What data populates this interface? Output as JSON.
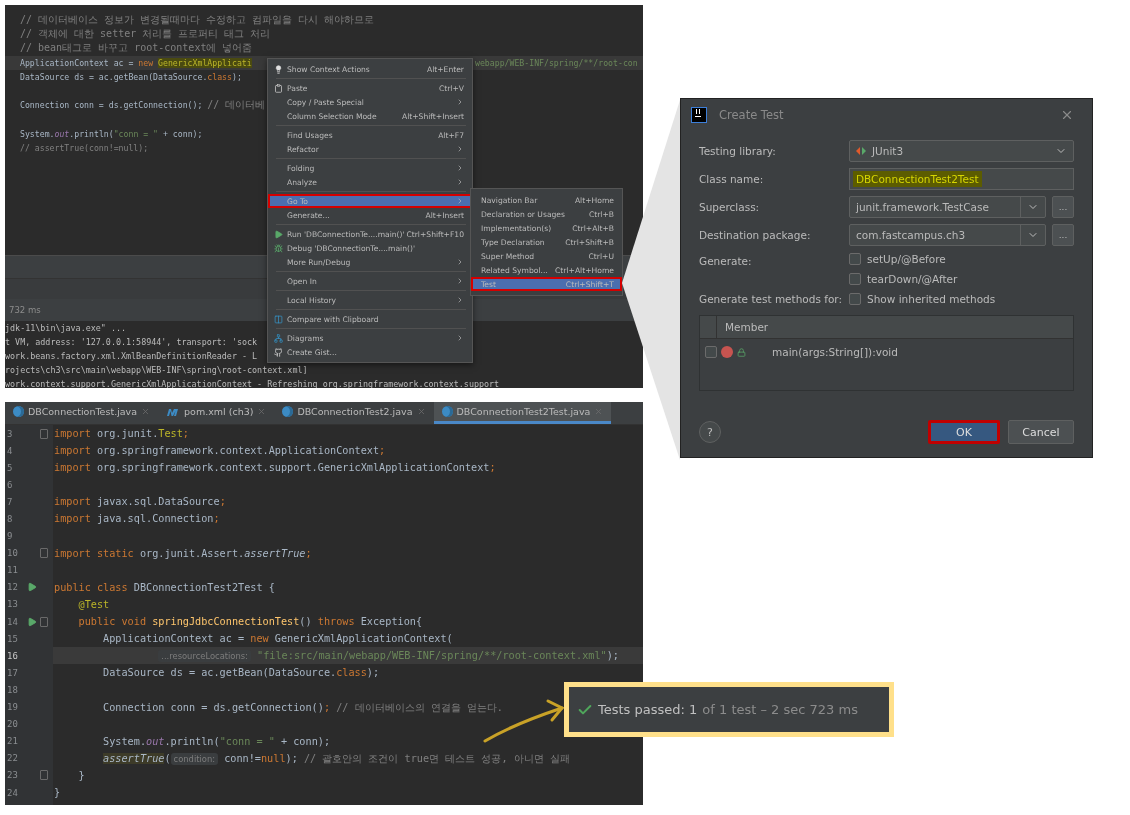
{
  "top_editor": {
    "lines": [
      {
        "current": false,
        "segments": [
          {
            "text": "// 데이터베이스 정보가 변경될때마다 수정하고 컴파일을 다시 해야하므로",
            "kind": "comment"
          }
        ]
      },
      {
        "current": false,
        "segments": [
          {
            "text": "// 객체에 대한 setter 처리를 프로퍼티 태그 처리",
            "kind": "comment"
          }
        ]
      },
      {
        "current": false,
        "segments": [
          {
            "text": "// bean태그로 바꾸고 root-context에 넣어줌",
            "kind": "comment"
          }
        ]
      },
      {
        "current": true,
        "segments": [
          {
            "text": "ApplicationContext ac = ",
            "kind": "plain"
          },
          {
            "text": "new ",
            "kind": "keyword"
          },
          {
            "text": "GenericXmlApplicati",
            "kind": "highlight"
          }
        ],
        "tail": {
          "text": "webapp/WEB-INF/spring/**/root-con",
          "kind": "string"
        }
      },
      {
        "current": false,
        "segments": [
          {
            "text": "DataSource ds = ac.getBean(DataSource.",
            "kind": "plain"
          },
          {
            "text": "class",
            "kind": "keyword"
          },
          {
            "text": ");",
            "kind": "plain"
          }
        ]
      },
      {
        "current": false
      },
      {
        "current": false,
        "segments": [
          {
            "text": "Connection conn = ds.getConnection(); ",
            "kind": "plain"
          },
          {
            "text": "// 데이터베",
            "kind": "comment"
          }
        ]
      },
      {
        "current": false
      },
      {
        "current": false,
        "segments": [
          {
            "text": "System.",
            "kind": "plain"
          },
          {
            "text": "out",
            "kind": "static"
          },
          {
            "text": ".println(",
            "kind": "plain"
          },
          {
            "text": "\"conn = \"",
            "kind": "string"
          },
          {
            "text": " + conn);",
            "kind": "plain"
          }
        ]
      },
      {
        "current": false,
        "segments": [
          {
            "text": "// assertTrue(conn!=null);",
            "kind": "comment"
          }
        ]
      }
    ]
  },
  "console": {
    "duration": "732 ms",
    "lines": [
      "jdk-11\\bin\\java.exe\" ...",
      "t VM, address: '127.0.0.1:58944', transport: 'sock",
      "work.beans.factory.xml.XmlBeanDefinitionReader - L",
      "rojects\\ch3\\src\\main\\webapp\\WEB-INF\\spring\\root-context.xml]",
      "work.context.support.GenericXmlApplicationContext - Refreshing org.springframework.context.support"
    ]
  },
  "context_menu": {
    "items": [
      {
        "kind": "item",
        "label": "Show Context Actions",
        "shortcut": "Alt+Enter",
        "submenu": false,
        "selected": false,
        "outlined": false
      },
      {
        "kind": "separator"
      },
      {
        "kind": "item",
        "label": "Paste",
        "shortcut": "Ctrl+V",
        "submenu": false,
        "selected": false,
        "outlined": false
      },
      {
        "kind": "item",
        "label": "Copy / Paste Special",
        "submenu": true,
        "selected": false,
        "outlined": false
      },
      {
        "kind": "item",
        "label": "Column Selection Mode",
        "shortcut": "Alt+Shift+Insert",
        "submenu": false,
        "selected": false,
        "outlined": false
      },
      {
        "kind": "separator"
      },
      {
        "kind": "item",
        "label": "Find Usages",
        "shortcut": "Alt+F7",
        "submenu": false,
        "selected": false,
        "outlined": false
      },
      {
        "kind": "item",
        "label": "Refactor",
        "submenu": true,
        "selected": false,
        "outlined": false
      },
      {
        "kind": "separator"
      },
      {
        "kind": "item",
        "label": "Folding",
        "submenu": true,
        "selected": false,
        "outlined": false
      },
      {
        "kind": "item",
        "label": "Analyze",
        "submenu": true,
        "selected": false,
        "outlined": false
      },
      {
        "kind": "separator"
      },
      {
        "kind": "item",
        "label": "Go To",
        "submenu": true,
        "selected": true,
        "outlined": true
      },
      {
        "kind": "item",
        "label": "Generate...",
        "shortcut": "Alt+Insert",
        "submenu": false,
        "selected": false,
        "outlined": false
      },
      {
        "kind": "separator"
      },
      {
        "kind": "item",
        "label": "Run 'DBConnectionTe....main()'",
        "shortcut": "Ctrl+Shift+F10",
        "submenu": false,
        "selected": false,
        "outlined": false
      },
      {
        "kind": "item",
        "label": "Debug 'DBConnectionTe....main()'",
        "submenu": false,
        "selected": false,
        "outlined": false
      },
      {
        "kind": "item",
        "label": "More Run/Debug",
        "submenu": true,
        "selected": false,
        "outlined": false
      },
      {
        "kind": "separator"
      },
      {
        "kind": "item",
        "label": "Open In",
        "submenu": true,
        "selected": false,
        "outlined": false
      },
      {
        "kind": "separator"
      },
      {
        "kind": "item",
        "label": "Local History",
        "submenu": true,
        "selected": false,
        "outlined": false
      },
      {
        "kind": "separator"
      },
      {
        "kind": "item",
        "label": "Compare with Clipboard",
        "submenu": false,
        "selected": false,
        "outlined": false
      },
      {
        "kind": "separator"
      },
      {
        "kind": "item",
        "label": "Diagrams",
        "submenu": true,
        "selected": false,
        "outlined": false
      },
      {
        "kind": "item",
        "label": "Create Gist...",
        "submenu": false,
        "selected": false,
        "outlined": false
      }
    ]
  },
  "submenu": {
    "items": [
      {
        "label": "Navigation Bar",
        "shortcut": "Alt+Home",
        "selected": false,
        "outlined": false
      },
      {
        "label": "Declaration or Usages",
        "shortcut": "Ctrl+B",
        "selected": false,
        "outlined": false
      },
      {
        "label": "Implementation(s)",
        "shortcut": "Ctrl+Alt+B",
        "selected": false,
        "outlined": false
      },
      {
        "label": "Type Declaration",
        "shortcut": "Ctrl+Shift+B",
        "selected": false,
        "outlined": false
      },
      {
        "label": "Super Method",
        "shortcut": "Ctrl+U",
        "selected": false,
        "outlined": false
      },
      {
        "label": "Related Symbol...",
        "shortcut": "Ctrl+Alt+Home",
        "selected": false,
        "outlined": false
      },
      {
        "label": "Test",
        "shortcut": "Ctrl+Shift+T",
        "selected": true,
        "outlined": true
      }
    ]
  },
  "dialog": {
    "title": "Create Test",
    "testing_library": {
      "label": "Testing library:",
      "value": "JUnit3"
    },
    "class_name": {
      "label": "Class name:",
      "value": "DBConnectionTest2Test",
      "highlighted": true
    },
    "superclass": {
      "label": "Superclass:",
      "value": "junit.framework.TestCase",
      "browse": "..."
    },
    "destination_package": {
      "label": "Destination package:",
      "value": "com.fastcampus.ch3",
      "browse": "..."
    },
    "generate": {
      "label": "Generate:",
      "options": [
        {
          "label": "setUp/@Before",
          "checked": false
        },
        {
          "label": "tearDown/@After",
          "checked": false
        }
      ]
    },
    "test_methods": {
      "label": "Generate test methods for:",
      "option": {
        "label": "Show inherited methods",
        "checked": false
      }
    },
    "members": {
      "column": "Member",
      "rows": [
        {
          "name": "main(args:String[]):void",
          "checked": false
        }
      ]
    },
    "help": "?",
    "buttons": [
      {
        "label": "OK",
        "primary": true,
        "outlined": true
      },
      {
        "label": "Cancel",
        "primary": false,
        "outlined": false
      }
    ]
  },
  "bottom_editor": {
    "tabs": [
      {
        "label": "DBConnectionTest.java",
        "kind": "java",
        "selected": false
      },
      {
        "label": "pom.xml (ch3)",
        "kind": "maven",
        "selected": false
      },
      {
        "label": "DBConnectionTest2.java",
        "kind": "java",
        "selected": false
      },
      {
        "label": "DBConnectionTest2Test.java",
        "kind": "java",
        "selected": true
      }
    ],
    "lines": [
      {
        "number": "3",
        "current": false,
        "run": false,
        "fold": true,
        "segments": [
          {
            "text": "import",
            "kind": "keyword"
          },
          {
            "text": " org.junit.",
            "kind": "plain"
          },
          {
            "text": "Test",
            "kind": "annotation"
          },
          {
            "text": ";",
            "kind": "keyword"
          }
        ]
      },
      {
        "number": "4",
        "current": false,
        "run": false,
        "fold": false,
        "segments": [
          {
            "text": "import",
            "kind": "keyword"
          },
          {
            "text": " org.springframework.context.ApplicationContext",
            "kind": "plain"
          },
          {
            "text": ";",
            "kind": "keyword"
          }
        ]
      },
      {
        "number": "5",
        "current": false,
        "run": false,
        "fold": false,
        "segments": [
          {
            "text": "import",
            "kind": "keyword"
          },
          {
            "text": " org.springframework.context.support.GenericXmlApplicationContext",
            "kind": "plain"
          },
          {
            "text": ";",
            "kind": "keyword"
          }
        ]
      },
      {
        "number": "6",
        "current": false,
        "run": false,
        "fold": false
      },
      {
        "number": "7",
        "current": false,
        "run": false,
        "fold": false,
        "segments": [
          {
            "text": "import",
            "kind": "keyword"
          },
          {
            "text": " javax.sql.DataSource",
            "kind": "plain"
          },
          {
            "text": ";",
            "kind": "keyword"
          }
        ]
      },
      {
        "number": "8",
        "current": false,
        "run": false,
        "fold": false,
        "segments": [
          {
            "text": "import",
            "kind": "keyword"
          },
          {
            "text": " java.sql.Connection",
            "kind": "plain"
          },
          {
            "text": ";",
            "kind": "keyword"
          }
        ]
      },
      {
        "number": "9",
        "current": false,
        "run": false,
        "fold": false
      },
      {
        "number": "10",
        "current": false,
        "run": false,
        "fold": true,
        "segments": [
          {
            "text": "import static",
            "kind": "keyword"
          },
          {
            "text": " org.junit.Assert.",
            "kind": "plain"
          },
          {
            "text": "assertTrue",
            "kind": "italic"
          },
          {
            "text": ";",
            "kind": "keyword"
          }
        ]
      },
      {
        "number": "11",
        "current": false,
        "run": false,
        "fold": false
      },
      {
        "number": "12",
        "current": false,
        "run": true,
        "fold": false,
        "segments": [
          {
            "text": "public class",
            "kind": "keyword"
          },
          {
            "text": " DBConnectionTest2Test {",
            "kind": "plain"
          }
        ]
      },
      {
        "number": "13",
        "current": false,
        "run": false,
        "fold": false,
        "segments": [
          {
            "text": "    @Test",
            "kind": "annotation"
          }
        ]
      },
      {
        "number": "14",
        "current": false,
        "run": true,
        "fold": true,
        "segments": [
          {
            "text": "    public void ",
            "kind": "keyword"
          },
          {
            "text": "springJdbcConnectionTest",
            "kind": "method"
          },
          {
            "text": "() ",
            "kind": "plain"
          },
          {
            "text": "throws",
            "kind": "keyword"
          },
          {
            "text": " Exception{",
            "kind": "plain"
          }
        ]
      },
      {
        "number": "15",
        "current": false,
        "run": false,
        "fold": false,
        "segments": [
          {
            "text": "        ApplicationContext ac = ",
            "kind": "plain"
          },
          {
            "text": "new",
            "kind": "keyword"
          },
          {
            "text": " GenericXmlApplicationContext(",
            "kind": "plain"
          }
        ]
      },
      {
        "number": "16",
        "current": true,
        "run": false,
        "fold": false,
        "segments": [
          {
            "text": "                 ...resourceLocations:",
            "kind": "hint"
          },
          {
            "text": " \"file:src/main/webapp/WEB-INF/spring/**/root-context.xml\"",
            "kind": "string"
          },
          {
            "text": ");",
            "kind": "plain"
          }
        ]
      },
      {
        "number": "17",
        "current": false,
        "run": false,
        "fold": false,
        "segments": [
          {
            "text": "        DataSource ds = ac.getBean(DataSource.",
            "kind": "plain"
          },
          {
            "text": "class",
            "kind": "keyword"
          },
          {
            "text": ");",
            "kind": "plain"
          }
        ]
      },
      {
        "number": "18",
        "current": false,
        "run": false,
        "fold": false
      },
      {
        "number": "19",
        "current": false,
        "run": false,
        "fold": false,
        "segments": [
          {
            "text": "        Connection conn = ds.getConnection()",
            "kind": "plain"
          },
          {
            "text": "; ",
            "kind": "keyword"
          },
          {
            "text": "// 데이터베이스의 연결을 얻는다.",
            "kind": "comment"
          }
        ]
      },
      {
        "number": "20",
        "current": false,
        "run": false,
        "fold": false
      },
      {
        "number": "21",
        "current": false,
        "run": false,
        "fold": false,
        "segments": [
          {
            "text": "        System.",
            "kind": "plain"
          },
          {
            "text": "out",
            "kind": "static"
          },
          {
            "text": ".println(",
            "kind": "plain"
          },
          {
            "text": "\"conn = \"",
            "kind": "string"
          },
          {
            "text": " + conn);",
            "kind": "plain"
          }
        ]
      },
      {
        "number": "22",
        "current": false,
        "run": false,
        "fold": false,
        "segments": [
          {
            "text": "        assertTrue",
            "kind": "italic-hl"
          },
          {
            "text": "(",
            "kind": "plain"
          },
          {
            "text": "condition:",
            "kind": "hint"
          },
          {
            "text": " conn!=",
            "kind": "plain"
          },
          {
            "text": "null",
            "kind": "keyword"
          },
          {
            "text": "); ",
            "kind": "plain"
          },
          {
            "text": "// 괄호안의 조건이 true면 테스트 성공, 아니면 실패",
            "kind": "comment"
          }
        ]
      },
      {
        "number": "23",
        "current": false,
        "run": false,
        "fold": true,
        "segments": [
          {
            "text": "    }",
            "kind": "plain"
          }
        ]
      },
      {
        "number": "24",
        "current": false,
        "run": false,
        "fold": false,
        "segments": [
          {
            "text": "}",
            "kind": "plain"
          }
        ]
      }
    ]
  },
  "test_result": {
    "summary": "Tests passed: 1",
    "detail": "of 1 test – 2 sec 723 ms"
  }
}
